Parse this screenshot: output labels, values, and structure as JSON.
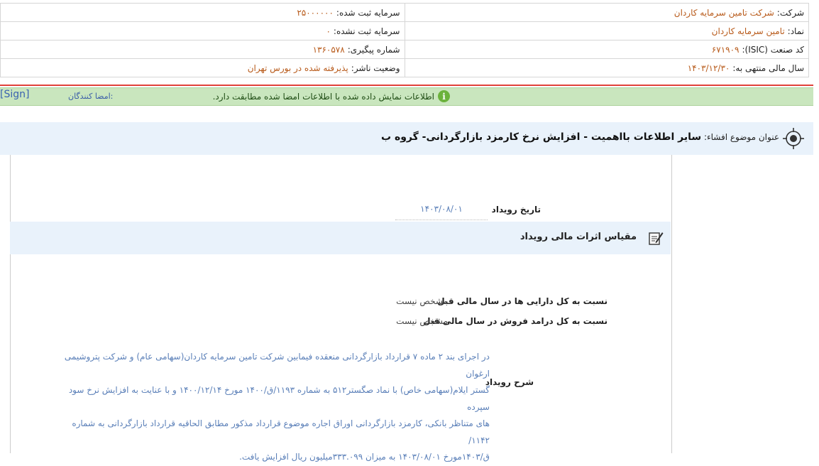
{
  "company": {
    "label": "شرکت:",
    "value": "شرکت تامین سرمایه کاردان"
  },
  "capital_registered": {
    "label": "سرمایه ثبت شده:",
    "value": "۲۵۰۰۰۰۰۰"
  },
  "symbol": {
    "label": "نماد:",
    "value": "تامین سرمایه کاردان"
  },
  "capital_unregistered": {
    "label": "سرمایه ثبت نشده:",
    "value": "۰"
  },
  "isic": {
    "label": "کد صنعت (ISIC):",
    "value": "۶۷۱۹۰۹"
  },
  "tracking": {
    "label": "شماره پیگیری:",
    "value": "۱۳۶۰۵۷۸"
  },
  "fiscal_year": {
    "label": "سال مالی منتهی به:",
    "value": "۱۴۰۳/۱۲/۳۰"
  },
  "publisher_status": {
    "label": "وضعیت ناشر:",
    "value": "پذیرفته شده در بورس تهران"
  },
  "notice": {
    "icon": "info-icon",
    "text": "اطلاعات نمایش داده شده با اطلاعات امضا شده مطابقت دارد.",
    "signers_label": "امضا کنندگان:",
    "sign_link": "[Sign]"
  },
  "subject": {
    "prefix": "عنوان موضوع افشاء:",
    "title": "سایر اطلاعات بااهمیت - افزایش نرخ کارمزد بازارگردانی- گروه ب"
  },
  "event_date": {
    "label": "تاریخ رویداد",
    "value": "۱۴۰۳/۰۸/۰۱"
  },
  "section": {
    "title": "مقیاس اثرات مالی رویداد"
  },
  "ratios": [
    {
      "label": "نسبت به کل دارایی ها در سال مالی قبل",
      "value": "مشخص نیست"
    },
    {
      "label": "نسبت به کل درامد فروش در سال مالی قبل",
      "value": "مشخص نیست"
    }
  ],
  "description": {
    "label": "شرح رویداد",
    "lines": [
      "در اجرای بند ۲ ماده ۷ قرارداد بازارگردانی منعقده فیمابین شرکت تامین سرمایه کاردان(سهامی عام) و شرکت پتروشیمی ارغوان",
      "گستر ایلام(سهامی خاص) با نماد صگستر۵۱۲ به شماره ۱۱۹۳/ق/۱۴۰۰ مورخ ۱۴۰۰/۱۲/۱۴ و با عنایت به افزایش نرخ سود سپرده",
      "های متناظر بانکی، کارمزد بازارگردانی اوراق اجاره موضوع قرارداد مذکور مطابق الحاقیه قرارداد بازارگردانی به شماره ۱۱۴۲/",
      "ق/۱۴۰۳مورخ ۱۴۰۳/۰۸/۰۱ به میزان ۳۳۳.۰۹۹میلیون ریال افزایش یافت."
    ]
  },
  "colors": {
    "value": "#b85a1a",
    "link": "#3a62b0",
    "notice_bg": "#c9e6be",
    "header_bg": "#e9f2fb",
    "alert_line": "#e0413a"
  }
}
